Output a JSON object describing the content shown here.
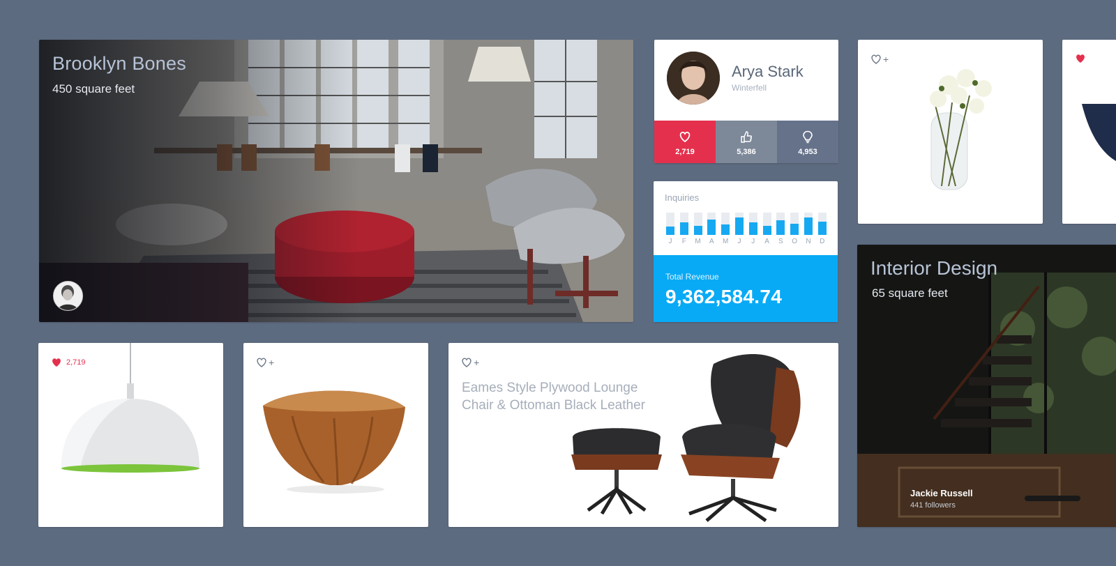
{
  "hero": {
    "title": "Brooklyn Bones",
    "subtitle": "450 square feet"
  },
  "profile": {
    "name": "Arya Stark",
    "location": "Winterfell",
    "stats": [
      {
        "icon": "heart-icon",
        "value": "2,719"
      },
      {
        "icon": "thumbs-up-icon",
        "value": "5,386"
      },
      {
        "icon": "lightbulb-icon",
        "value": "4,953"
      }
    ]
  },
  "inquiries": {
    "label": "Inquiries",
    "total_label": "Total Revenue",
    "total_value": "9,362,584.74"
  },
  "chart_data": {
    "type": "bar",
    "categories": [
      "J",
      "F",
      "M",
      "A",
      "M",
      "J",
      "J",
      "A",
      "S",
      "O",
      "N",
      "D"
    ],
    "values": [
      0.38,
      0.55,
      0.42,
      0.68,
      0.48,
      0.78,
      0.55,
      0.42,
      0.65,
      0.5,
      0.78,
      0.58
    ],
    "ylim": [
      0,
      1
    ]
  },
  "products": {
    "lamp": {
      "count": "2,719"
    },
    "eames": {
      "title": "Eames Style Plywood Lounge Chair & Ottoman Black Leather"
    }
  },
  "interior": {
    "title": "Interior Design",
    "subtitle": "65 square feet",
    "user_name": "Jackie Russell",
    "followers": "441 followers"
  },
  "colors": {
    "background": "#5d6b80",
    "accent_red": "#e5304d",
    "accent_blue": "#09aaf5"
  }
}
